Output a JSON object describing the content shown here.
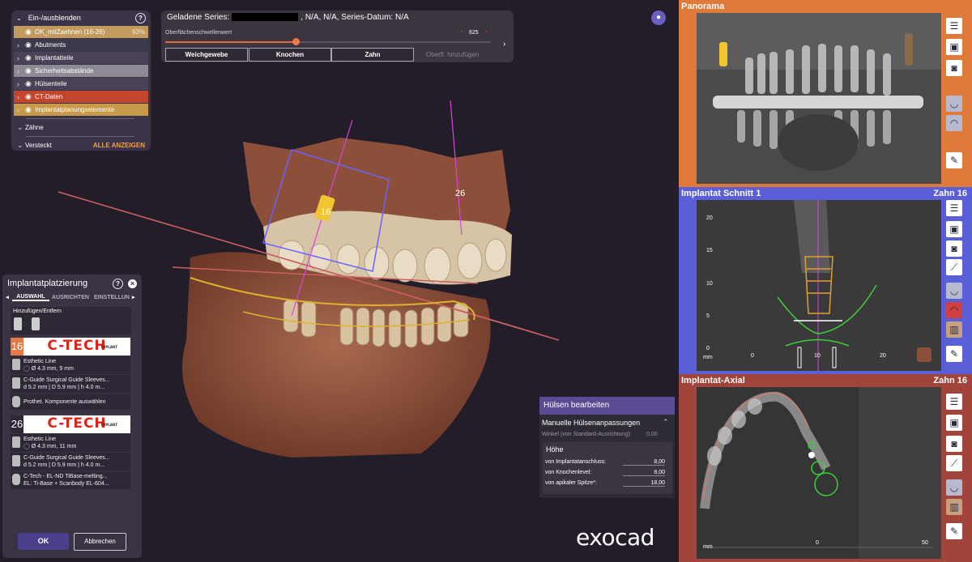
{
  "visibility_panel": {
    "title": "Ein-/ausblenden",
    "items": [
      {
        "label": "OK_mitZaehnen (16-26)",
        "percent": "63%",
        "color": "#c29a5e"
      },
      {
        "label": "Abutments",
        "color": "#3a3a4a"
      },
      {
        "label": "Implantatteile",
        "color": "#494257"
      },
      {
        "label": "Sicherheitsabstände",
        "color": "#8e8a94"
      },
      {
        "label": "Hülsenteile",
        "color": "#494257"
      },
      {
        "label": "CT-Daten",
        "color": "#c2452e"
      },
      {
        "label": "Implantatplanungselemente",
        "color": "#c79a4a"
      }
    ],
    "group_teeth": "Zähne",
    "group_hidden": "Versteckt",
    "show_all": "ALLE ANZEIGEN"
  },
  "series_panel": {
    "prefix": "Geladene Series:",
    "suffix": ", N/A, N/A, Series-Datum: N/A",
    "slider_label": "Oberflächenschwellenwert",
    "slider_value": "625",
    "slider_fraction": 0.4,
    "buttons": [
      "Weichgewebe",
      "Knochen",
      "Zahn"
    ],
    "add_surface": "Oberfl. hinzufügen"
  },
  "scene": {
    "label_left": "16",
    "label_right": "26"
  },
  "implant_panel": {
    "title": "Implantatplatzierung",
    "tabs": [
      "AUSWAHL",
      "AUSRICHTEN",
      "EINSTELLUN"
    ],
    "add_remove": "Hinzufügen/Entfern",
    "implants": [
      {
        "tooth": "16",
        "brand": "C-TECH",
        "brand_sub": "IMPLANT",
        "line": "Esthetic Line",
        "size": "Ø 4.3 mm, 9 mm",
        "sleeve_1": "C-Guide Surgical Guide Sleeves...",
        "sleeve_2": "d 5.2 mm | D 5.9 mm | h 4.0 m...",
        "component": "Prothet. Komponente auswählen"
      },
      {
        "tooth": "26",
        "brand": "C-TECH",
        "brand_sub": "IMPLANT",
        "line": "Esthetic Line",
        "size": "Ø 4.3 mm, 11 mm",
        "sleeve_1": "C-Guide Surgical Guide Sleeves...",
        "sleeve_2": "d 5.2 mm | D 5.9 mm | h 4.0 m...",
        "component_1": "C-Tech - EL-ND TiBase-melting...",
        "component_2": "EL: Ti-Base + Scanbody EL-604..."
      }
    ],
    "ok": "OK",
    "cancel": "Abbrechen"
  },
  "sleeve_panel": {
    "title": "Hülsen bearbeiten",
    "section": "Manuelle Hülsenanpassungen",
    "angle_label": "Winkel (von Standard-Ausrichtung):",
    "angle_value": "0,00",
    "height_title": "Höhe",
    "rows": [
      {
        "label": "von Implantatanschluss:",
        "value": "8,00"
      },
      {
        "label": "von Knochenlevel:",
        "value": "8,00"
      },
      {
        "label": "von apikaler Spitze*:",
        "value": "18,00"
      }
    ]
  },
  "logo": "exocad",
  "views": {
    "panorama": {
      "title": "Panorama",
      "color": "#e07a3a"
    },
    "section": {
      "title": "Implantat Schnitt 1",
      "tooth": "Zahn 16",
      "color": "#5a5fd8",
      "y_ticks": [
        "20",
        "15",
        "10",
        "5",
        "0"
      ],
      "x_ticks": [
        "0",
        "10",
        "20"
      ],
      "unit": "mm"
    },
    "axial": {
      "title": "Implantat-Axial",
      "tooth": "Zahn 16",
      "color": "#a0443c",
      "x_ticks": [
        "0"
      ],
      "unit": "mm",
      "scale": "50"
    }
  }
}
